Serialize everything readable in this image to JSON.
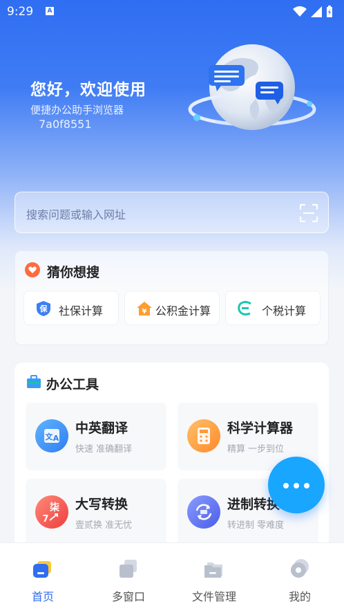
{
  "status_bar": {
    "time": "9:29",
    "notification_icon": "A"
  },
  "hero": {
    "greeting": "您好，欢迎使用",
    "subtitle": "便捷办公助手浏览器",
    "device_id": "7a0f8551"
  },
  "search": {
    "placeholder": "搜索问题或输入网址"
  },
  "guess": {
    "title": "猜你想搜",
    "items": [
      {
        "label": "社保计算",
        "icon": "social-security-icon"
      },
      {
        "label": "公积金计算",
        "icon": "housing-fund-icon"
      },
      {
        "label": "个税计算",
        "icon": "income-tax-icon"
      }
    ]
  },
  "office": {
    "title": "办公工具",
    "tools": [
      {
        "name": "中英翻译",
        "desc": "快速 准确翻译",
        "icon": "translate-icon",
        "color": "#2f8cf5"
      },
      {
        "name": "科学计算器",
        "desc": "精算 一步到位",
        "icon": "calculator-icon",
        "color": "#ff9a3a"
      },
      {
        "name": "大写转换",
        "desc": "壹贰换 准无忧",
        "icon": "uppercase-convert-icon",
        "color": "#f2554a"
      },
      {
        "name": "进制转换",
        "desc": "转进制 零难度",
        "icon": "base-convert-icon",
        "color": "#5a6cf0"
      }
    ]
  },
  "nav": {
    "items": [
      {
        "label": "首页",
        "active": true
      },
      {
        "label": "多窗口",
        "active": false
      },
      {
        "label": "文件管理",
        "active": false
      },
      {
        "label": "我的",
        "active": false
      }
    ]
  },
  "colors": {
    "accent": "#2f6ef2",
    "fab": "#18a6ff",
    "active_nav": "#2f6ef2"
  }
}
